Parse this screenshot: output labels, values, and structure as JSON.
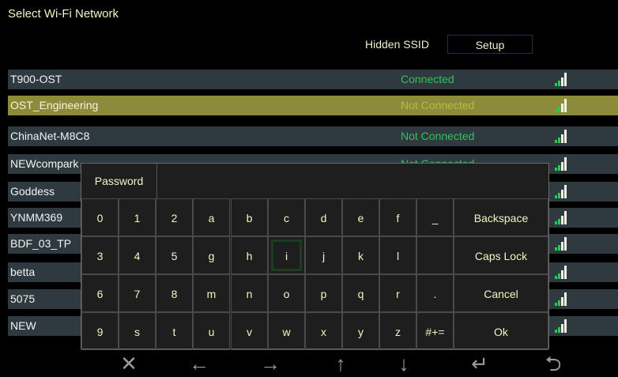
{
  "title": "Select Wi-Fi Network",
  "hidden_ssid_label": "Hidden SSID",
  "setup_label": "Setup",
  "networks": [
    {
      "name": "T900-OST",
      "status": "Connected",
      "signal": 4
    },
    {
      "name": "OST_Engineering",
      "status": "Not Connected",
      "signal": 4
    },
    {
      "name": "ChinaNet-M8C8",
      "status": "Not Connected",
      "signal": 4
    },
    {
      "name": "NEWcompark",
      "status": "Not Connected",
      "signal": 4
    },
    {
      "name": "Goddess",
      "status": "",
      "signal": 4
    },
    {
      "name": "YNMM369",
      "status": "",
      "signal": 4
    },
    {
      "name": "BDF_03_TP",
      "status": "",
      "signal": 4
    },
    {
      "name": "betta",
      "status": "",
      "signal": 4
    },
    {
      "name": "5075",
      "status": "",
      "signal": 4
    },
    {
      "name": "NEW",
      "status": "",
      "signal": 4
    }
  ],
  "selected_index": 1,
  "keyboard": {
    "password_label": "Password",
    "password_value": "",
    "rows": [
      [
        "0",
        "1",
        "2",
        "a",
        "b",
        "c",
        "d",
        "e",
        "f",
        "_"
      ],
      [
        "3",
        "4",
        "5",
        "g",
        "h",
        "i",
        "j",
        "k",
        "l",
        ""
      ],
      [
        "6",
        "7",
        "8",
        "m",
        "n",
        "o",
        "p",
        "q",
        "r",
        "."
      ],
      [
        "9",
        "s",
        "t",
        "u",
        "v",
        "w",
        "x",
        "y",
        "z",
        "#+="
      ]
    ],
    "actions": [
      "Backspace",
      "Caps Lock",
      "Cancel",
      "Ok"
    ],
    "focused_key": "i"
  },
  "nav_icons": [
    "close-icon",
    "arrow-left-icon",
    "arrow-right-icon",
    "arrow-up-icon",
    "arrow-down-icon",
    "enter-icon",
    "back-icon"
  ],
  "nav_glyphs": [
    "✕",
    "←",
    "→",
    "↑",
    "↓",
    "↵",
    "⮌"
  ],
  "colors": {
    "status_green": "#2fc35a",
    "selected_row": "#8c8b3b",
    "row_bg": "#2f3a40"
  }
}
